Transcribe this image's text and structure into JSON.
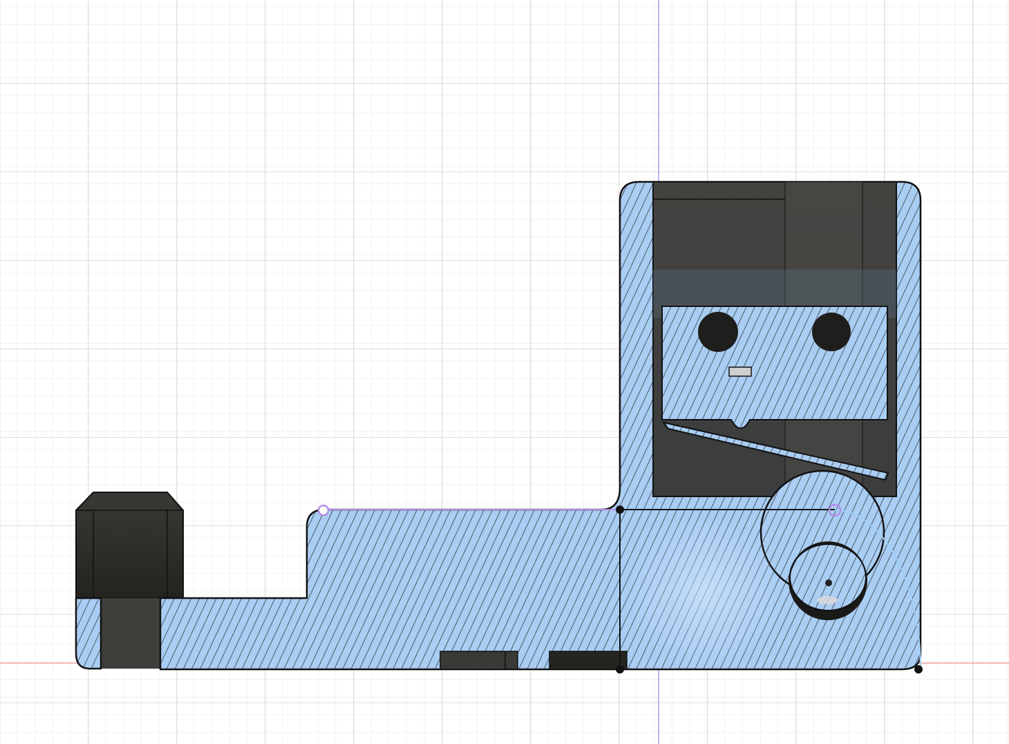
{
  "viewport": {
    "background": "#ffffff",
    "grid": {
      "visible": true,
      "minor_color": "#e6e6e6",
      "major_color": "#c9c9c9",
      "subdivisions": 5
    },
    "axes": {
      "vertical_axis_color": "#a6a0f0",
      "horizontal_axis_color": "#f2a1a1"
    }
  },
  "model": {
    "section_fill": "#a9cdf3",
    "hatch_color": "#1a1a1a",
    "outline_color": "#111111",
    "dark_body_color": "#3f3e3b",
    "components": [
      "section-body",
      "clip-housing",
      "hex-standoff",
      "spring-arm",
      "pivot-boss",
      "mount-holes",
      "foot-pads"
    ]
  },
  "sketch": {
    "line_color": "#b28ee6",
    "constraint_point_color": "#b28ee6",
    "arc_color": "#9fd0f5",
    "vertex_color": "#111111"
  }
}
